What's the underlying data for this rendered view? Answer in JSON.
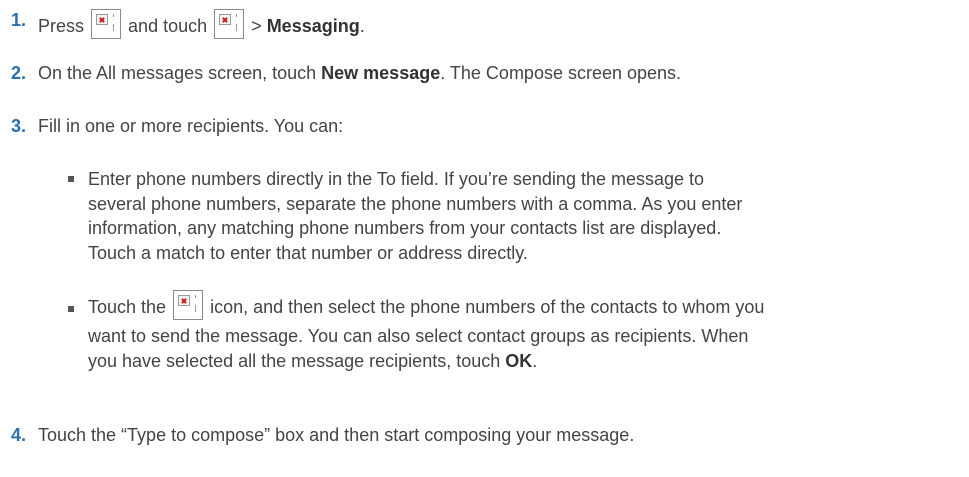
{
  "steps": [
    {
      "number": "1.",
      "parts": [
        "Press",
        "and touch",
        ">",
        "Messaging",
        "."
      ]
    },
    {
      "number": "2.",
      "pre": "On the All messages screen, touch ",
      "bold": "New message",
      "post": ". The Compose screen opens."
    },
    {
      "number": "3.",
      "text": "Fill in one or more recipients. You can:"
    },
    {
      "number": "4.",
      "text": "Touch the “Type to compose” box and then start composing your message."
    }
  ],
  "bullets": {
    "first": {
      "lines": [
        "Enter phone numbers directly in the To field. If you’re sending the message to",
        "several phone numbers, separate the phone numbers with a comma. As you enter",
        "information, any matching phone numbers from your contacts list are displayed.",
        "Touch a match to enter that number or address directly."
      ]
    },
    "second": {
      "line1_pre": "Touch the",
      "line1_post": "icon, and then select the phone numbers of the contacts to whom you",
      "line2": "want to send the message. You can also select contact groups as recipients. When",
      "line3_pre": "you have selected all the message recipients, touch ",
      "line3_bold": "OK",
      "line3_post": "."
    }
  },
  "icons": [
    "home-key-icon",
    "applications-icon",
    "contacts-icon"
  ],
  "colors": {
    "step_number": "#2a6fb0",
    "body_text": "#444444"
  }
}
